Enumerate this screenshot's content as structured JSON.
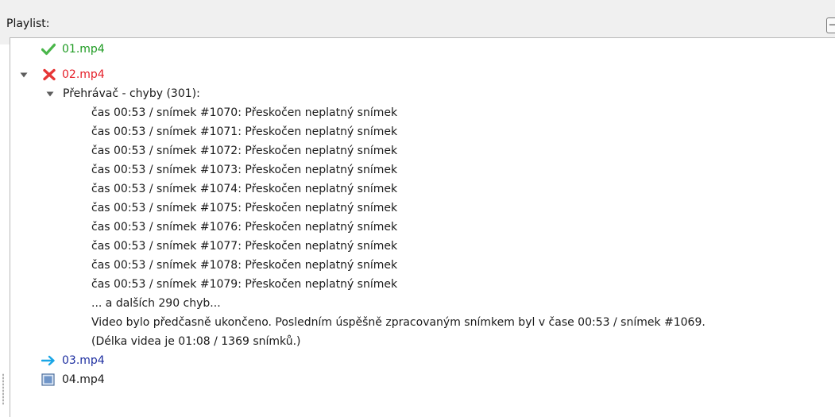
{
  "header": {
    "label": "Playlist:",
    "collapse_glyph": "−"
  },
  "items": [
    {
      "name": "01.mp4",
      "status": "ok",
      "icon": "check-icon"
    },
    {
      "name": "02.mp4",
      "status": "error",
      "icon": "cross-icon",
      "expanded": true,
      "group": {
        "title": "Přehrávač - chyby (301):",
        "errors": [
          "čas 00:53 / snímek #1070: Přeskočen neplatný snímek",
          "čas 00:53 / snímek #1071: Přeskočen neplatný snímek",
          "čas 00:53 / snímek #1072: Přeskočen neplatný snímek",
          "čas 00:53 / snímek #1073: Přeskočen neplatný snímek",
          "čas 00:53 / snímek #1074: Přeskočen neplatný snímek",
          "čas 00:53 / snímek #1075: Přeskočen neplatný snímek",
          "čas 00:53 / snímek #1076: Přeskočen neplatný snímek",
          "čas 00:53 / snímek #1077: Přeskočen neplatný snímek",
          "čas 00:53 / snímek #1078: Přeskočen neplatný snímek",
          "čas 00:53 / snímek #1079: Přeskočen neplatný snímek"
        ],
        "more": "... a dalších 290 chyb...",
        "summary": "Video bylo předčasně ukončeno. Posledním úspěšně zpracovaným snímkem byl v čase 00:53 / snímek #1069.",
        "length": "(Délka videa je 01:08 / 1369 snímků.)"
      }
    },
    {
      "name": "03.mp4",
      "status": "playing",
      "icon": "arrow-right-icon"
    },
    {
      "name": "04.mp4",
      "status": "pending",
      "icon": "window-icon"
    }
  ],
  "colors": {
    "ok": "#1e9b22",
    "error": "#e5202a",
    "playing": "#1e2fa0",
    "arrow": "#1aa6e6"
  }
}
